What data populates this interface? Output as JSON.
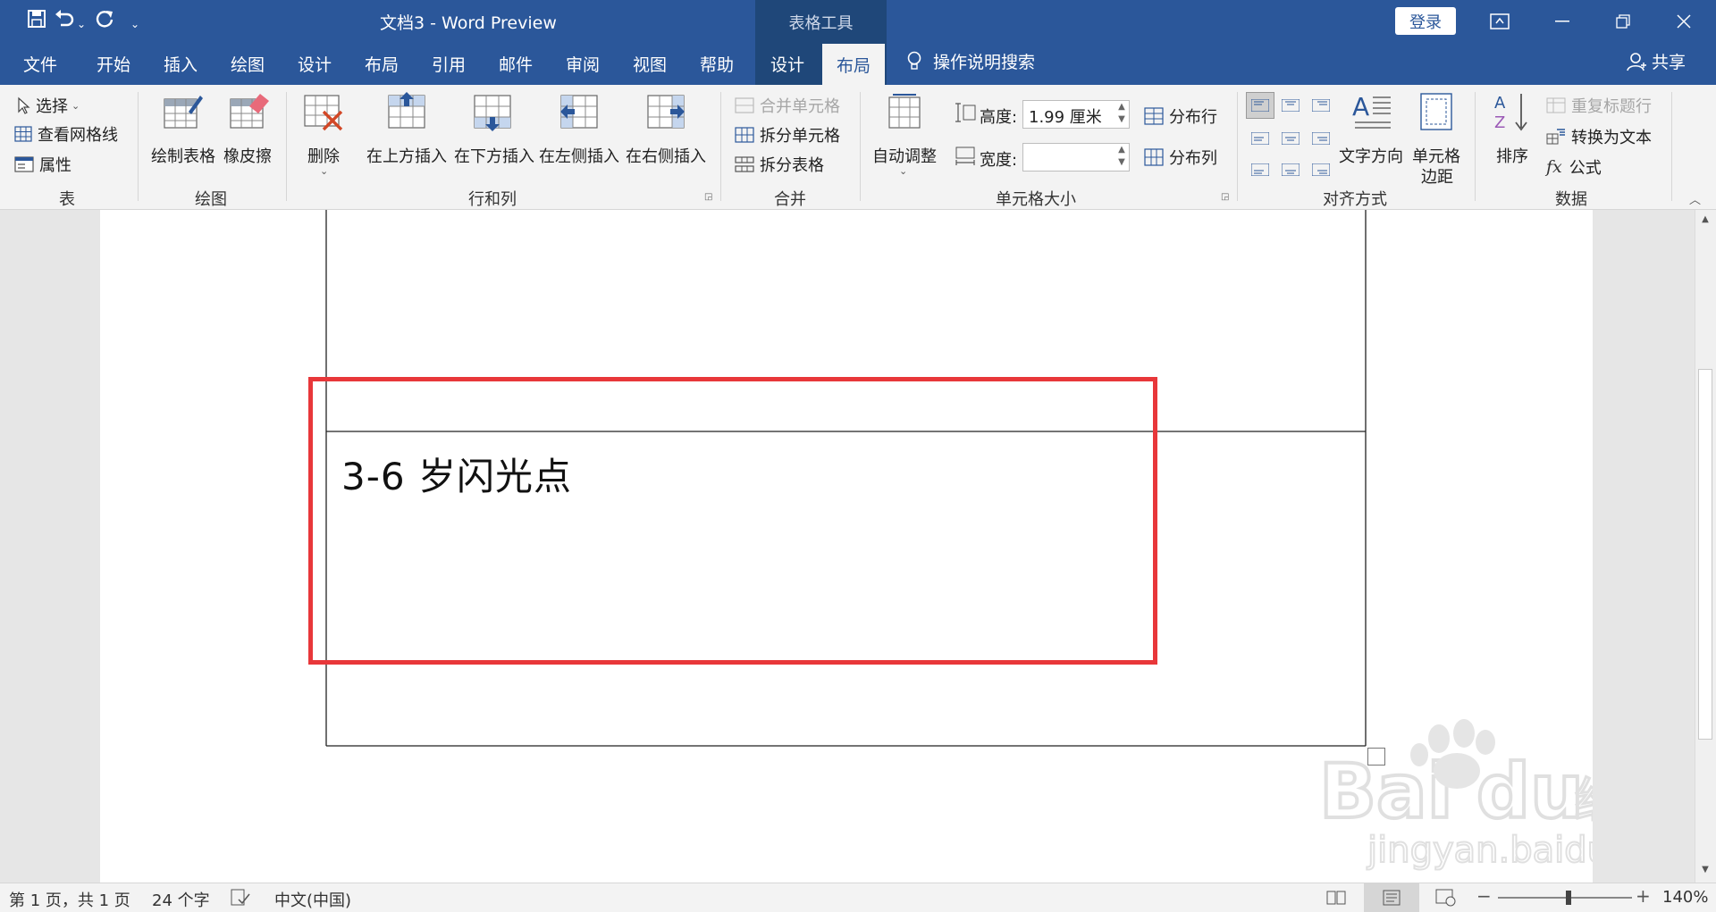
{
  "window": {
    "title": "文档3  -  Word Preview",
    "context_tab_group": "表格工具",
    "login_label": "登录"
  },
  "tabs": [
    "文件",
    "开始",
    "插入",
    "绘图",
    "设计",
    "布局",
    "引用",
    "邮件",
    "审阅",
    "视图",
    "帮助",
    "设计",
    "布局"
  ],
  "active_tab": "布局",
  "tell_me": "操作说明搜索",
  "share": "共享",
  "ribbon": {
    "table": {
      "label": "表",
      "select": "选择",
      "gridlines": "查看网格线",
      "properties": "属性"
    },
    "draw": {
      "label": "绘图",
      "draw_table": "绘制表格",
      "eraser": "橡皮擦"
    },
    "rows_cols": {
      "label": "行和列",
      "delete": "删除",
      "insert_above": "在上方插入",
      "insert_below": "在下方插入",
      "insert_left": "在左侧插入",
      "insert_right": "在右侧插入"
    },
    "merge": {
      "label": "合并",
      "merge_cells": "合并单元格",
      "split_cells": "拆分单元格",
      "split_table": "拆分表格"
    },
    "cell_size": {
      "label": "单元格大小",
      "autofit": "自动调整",
      "height_label": "高度:",
      "height_value": "1.99 厘米",
      "width_label": "宽度:",
      "width_value": "",
      "distribute_rows": "分布行",
      "distribute_cols": "分布列"
    },
    "alignment": {
      "label": "对齐方式",
      "text_direction": "文字方向",
      "cell_margins_l1": "单元格",
      "cell_margins_l2": "边距"
    },
    "data": {
      "label": "数据",
      "sort": "排序",
      "repeat_header": "重复标题行",
      "convert_to_text": "转换为文本",
      "formula": "公式"
    }
  },
  "document": {
    "cell_text": "3-6 岁闪光点"
  },
  "status": {
    "page": "第 1 页，共 1 页",
    "words": "24 个字",
    "language": "中文(中国)",
    "zoom": "140%"
  },
  "colors": {
    "accent": "#2b579a",
    "highlight_box": "#e8373a"
  }
}
